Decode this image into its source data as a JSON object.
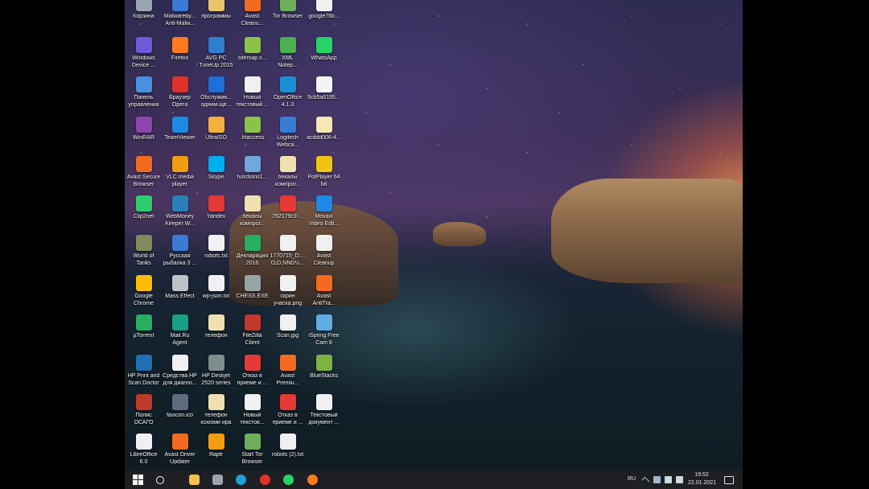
{
  "desktop": {
    "icons": [
      {
        "label": "Корзина",
        "color": "#9aa5b1"
      },
      {
        "label": "Malwareby...\nAnti-Malw...",
        "color": "#3a7bd5"
      },
      {
        "label": "программы",
        "color": "#e9c46a"
      },
      {
        "label": "Avast\nCleanu...",
        "color": "#f26b21"
      },
      {
        "label": "Tor Browser",
        "color": "#6fae5a"
      },
      {
        "label": "google76b...",
        "color": "#f0f0f0"
      },
      {
        "label": "Windows\nDevice ...",
        "color": "#6b5bd6"
      },
      {
        "label": "Firefox",
        "color": "#ff7a1a"
      },
      {
        "label": "AVG PC\nTuneUp 2015",
        "color": "#2f7fd1"
      },
      {
        "label": "sitemap.x...",
        "color": "#8bc34a"
      },
      {
        "label": "XML\nNotep...",
        "color": "#4caf50"
      },
      {
        "label": "WhatsApp",
        "color": "#25d366"
      },
      {
        "label": "Панель\nуправления",
        "color": "#4a90e2"
      },
      {
        "label": "Браузер\nOpera",
        "color": "#e0312b"
      },
      {
        "label": "Обслужив...\nодним ще...",
        "color": "#1e6fd9"
      },
      {
        "label": "Новый\nтекстовый ...",
        "color": "#f0f0f0"
      },
      {
        "label": "OpenOffice\n4.1.3",
        "color": "#1b8fd6"
      },
      {
        "label": "5cb5a6195...",
        "color": "#f4f4f4"
      },
      {
        "label": "WinRAR",
        "color": "#8e44ad"
      },
      {
        "label": "TeamViewer",
        "color": "#1e88e5"
      },
      {
        "label": "UltraISO",
        "color": "#f3b23c"
      },
      {
        "label": ".htaccess",
        "color": "#8bc34a"
      },
      {
        "label": "Logitech\nWebca...",
        "color": "#3a7bd5"
      },
      {
        "label": "acddd006-4...",
        "color": "#f6e7b4"
      },
      {
        "label": "Avast Secure\nBrowser",
        "color": "#f26b21"
      },
      {
        "label": "VLC media\nplayer",
        "color": "#f39c12"
      },
      {
        "label": "Skype",
        "color": "#00aff0"
      },
      {
        "label": "functions1...",
        "color": "#6fa8dc"
      },
      {
        "label": "бекалы\nкомпрог...",
        "color": "#f0e0b0"
      },
      {
        "label": "PotPlayer 64\nbit",
        "color": "#f1c40f"
      },
      {
        "label": "Clip2net",
        "color": "#2ecc71"
      },
      {
        "label": "WebMoney\nKeeper W...",
        "color": "#2980b9"
      },
      {
        "label": "Yandex",
        "color": "#e53935"
      },
      {
        "label": "бекалы\nкомпрог...",
        "color": "#f0e0b0"
      },
      {
        "label": "792179c3-...",
        "color": "#e53935"
      },
      {
        "label": "Movavi\nVideo Edit...",
        "color": "#1e88e5"
      },
      {
        "label": "World of\nTanks",
        "color": "#7f8c5a"
      },
      {
        "label": "Русская\nрыбалка 3 ...",
        "color": "#3a7bd5"
      },
      {
        "label": "robots.txt",
        "color": "#f0f0f0"
      },
      {
        "label": "Декларация\n2016",
        "color": "#27ae60"
      },
      {
        "label": "1770715_D;...\nD¡D,NND¼...",
        "color": "#f0f0f0"
      },
      {
        "label": "Avast\nCleanup",
        "color": "#f0f0f0"
      },
      {
        "label": "Google\nChrome",
        "color": "#fbbc05"
      },
      {
        "label": "Mass Effect",
        "color": "#bdc3c7"
      },
      {
        "label": "wp-json.txt",
        "color": "#f0f0f0"
      },
      {
        "label": "CHESS.EXE",
        "color": "#95a5a6"
      },
      {
        "label": "скрин\nучаска.png",
        "color": "#f0f0f0"
      },
      {
        "label": "Avast\nAntiTra...",
        "color": "#f26b21"
      },
      {
        "label": "µTorrent",
        "color": "#27ae60"
      },
      {
        "label": "Mail.Ru\nAgent",
        "color": "#16a085"
      },
      {
        "label": "телефон",
        "color": "#f0e0b0"
      },
      {
        "label": "FileZilla\nClient",
        "color": "#c0392b"
      },
      {
        "label": "Scan.jpg",
        "color": "#f0f0f0"
      },
      {
        "label": "iSpring Free\nCam 8",
        "color": "#5dade2"
      },
      {
        "label": "HP Print and\nScan Doctor",
        "color": "#1f6fb2"
      },
      {
        "label": "Средства HP\nдля диагно...",
        "color": "#f0f0f0"
      },
      {
        "label": "HP Deskjet\n2520 series",
        "color": "#7f8c8d"
      },
      {
        "label": "Отказ в\nприеме и ...",
        "color": "#e53935"
      },
      {
        "label": "Avast\nPremiu...",
        "color": "#f26b21"
      },
      {
        "label": "BlueStacks",
        "color": "#7cb342"
      },
      {
        "label": "Полис\nОСАГО",
        "color": "#c0392b"
      },
      {
        "label": "favicon.ico",
        "color": "#5d6d7e"
      },
      {
        "label": "телефон\nксюоми ира",
        "color": "#f0e0b0"
      },
      {
        "label": "Новый\nтекстов...",
        "color": "#f0f0f0"
      },
      {
        "label": "Отказ в\nприеме и ...",
        "color": "#e53935"
      },
      {
        "label": "Текстовый\nдокумент ...",
        "color": "#f0f0f0"
      },
      {
        "label": "LibreOffice\n6.0",
        "color": "#f0f0f0"
      },
      {
        "label": "Avast Driver\nUpdater",
        "color": "#f26b21"
      },
      {
        "label": "Raptr",
        "color": "#f39c12"
      },
      {
        "label": "Start Tor\nBrowser",
        "color": "#6fae5a"
      },
      {
        "label": "robots (2).txt",
        "color": "#f0f0f0"
      }
    ]
  },
  "taskbar": {
    "pinned": [
      {
        "name": "start-button",
        "color": "#ffffff"
      },
      {
        "name": "search-button",
        "color": "#ffffff"
      },
      {
        "name": "file-explorer-button",
        "color": "#f2c14e"
      },
      {
        "name": "calculator-button",
        "color": "#9aa5b1"
      },
      {
        "name": "edge-button",
        "color": "#1ea1d8"
      },
      {
        "name": "opera-button",
        "color": "#e0312b"
      },
      {
        "name": "whatsapp-button",
        "color": "#25d366"
      },
      {
        "name": "firefox-button",
        "color": "#ff7a1a"
      }
    ],
    "language": "RU",
    "time": "19:52",
    "date": "22.01.2021"
  }
}
